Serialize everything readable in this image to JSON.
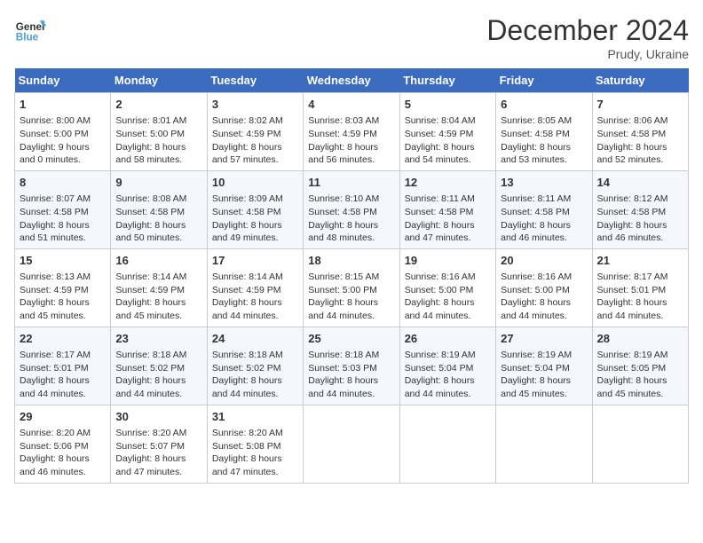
{
  "header": {
    "logo_line1": "General",
    "logo_line2": "Blue",
    "month": "December 2024",
    "location": "Prudy, Ukraine"
  },
  "weekdays": [
    "Sunday",
    "Monday",
    "Tuesday",
    "Wednesday",
    "Thursday",
    "Friday",
    "Saturday"
  ],
  "weeks": [
    [
      {
        "day": 1,
        "sunrise": "8:00 AM",
        "sunset": "5:00 PM",
        "daylight": "9 hours and 0 minutes."
      },
      {
        "day": 2,
        "sunrise": "8:01 AM",
        "sunset": "5:00 PM",
        "daylight": "8 hours and 58 minutes."
      },
      {
        "day": 3,
        "sunrise": "8:02 AM",
        "sunset": "4:59 PM",
        "daylight": "8 hours and 57 minutes."
      },
      {
        "day": 4,
        "sunrise": "8:03 AM",
        "sunset": "4:59 PM",
        "daylight": "8 hours and 56 minutes."
      },
      {
        "day": 5,
        "sunrise": "8:04 AM",
        "sunset": "4:59 PM",
        "daylight": "8 hours and 54 minutes."
      },
      {
        "day": 6,
        "sunrise": "8:05 AM",
        "sunset": "4:58 PM",
        "daylight": "8 hours and 53 minutes."
      },
      {
        "day": 7,
        "sunrise": "8:06 AM",
        "sunset": "4:58 PM",
        "daylight": "8 hours and 52 minutes."
      }
    ],
    [
      {
        "day": 8,
        "sunrise": "8:07 AM",
        "sunset": "4:58 PM",
        "daylight": "8 hours and 51 minutes."
      },
      {
        "day": 9,
        "sunrise": "8:08 AM",
        "sunset": "4:58 PM",
        "daylight": "8 hours and 50 minutes."
      },
      {
        "day": 10,
        "sunrise": "8:09 AM",
        "sunset": "4:58 PM",
        "daylight": "8 hours and 49 minutes."
      },
      {
        "day": 11,
        "sunrise": "8:10 AM",
        "sunset": "4:58 PM",
        "daylight": "8 hours and 48 minutes."
      },
      {
        "day": 12,
        "sunrise": "8:11 AM",
        "sunset": "4:58 PM",
        "daylight": "8 hours and 47 minutes."
      },
      {
        "day": 13,
        "sunrise": "8:11 AM",
        "sunset": "4:58 PM",
        "daylight": "8 hours and 46 minutes."
      },
      {
        "day": 14,
        "sunrise": "8:12 AM",
        "sunset": "4:58 PM",
        "daylight": "8 hours and 46 minutes."
      }
    ],
    [
      {
        "day": 15,
        "sunrise": "8:13 AM",
        "sunset": "4:59 PM",
        "daylight": "8 hours and 45 minutes."
      },
      {
        "day": 16,
        "sunrise": "8:14 AM",
        "sunset": "4:59 PM",
        "daylight": "8 hours and 45 minutes."
      },
      {
        "day": 17,
        "sunrise": "8:14 AM",
        "sunset": "4:59 PM",
        "daylight": "8 hours and 44 minutes."
      },
      {
        "day": 18,
        "sunrise": "8:15 AM",
        "sunset": "5:00 PM",
        "daylight": "8 hours and 44 minutes."
      },
      {
        "day": 19,
        "sunrise": "8:16 AM",
        "sunset": "5:00 PM",
        "daylight": "8 hours and 44 minutes."
      },
      {
        "day": 20,
        "sunrise": "8:16 AM",
        "sunset": "5:00 PM",
        "daylight": "8 hours and 44 minutes."
      },
      {
        "day": 21,
        "sunrise": "8:17 AM",
        "sunset": "5:01 PM",
        "daylight": "8 hours and 44 minutes."
      }
    ],
    [
      {
        "day": 22,
        "sunrise": "8:17 AM",
        "sunset": "5:01 PM",
        "daylight": "8 hours and 44 minutes."
      },
      {
        "day": 23,
        "sunrise": "8:18 AM",
        "sunset": "5:02 PM",
        "daylight": "8 hours and 44 minutes."
      },
      {
        "day": 24,
        "sunrise": "8:18 AM",
        "sunset": "5:02 PM",
        "daylight": "8 hours and 44 minutes."
      },
      {
        "day": 25,
        "sunrise": "8:18 AM",
        "sunset": "5:03 PM",
        "daylight": "8 hours and 44 minutes."
      },
      {
        "day": 26,
        "sunrise": "8:19 AM",
        "sunset": "5:04 PM",
        "daylight": "8 hours and 44 minutes."
      },
      {
        "day": 27,
        "sunrise": "8:19 AM",
        "sunset": "5:04 PM",
        "daylight": "8 hours and 45 minutes."
      },
      {
        "day": 28,
        "sunrise": "8:19 AM",
        "sunset": "5:05 PM",
        "daylight": "8 hours and 45 minutes."
      }
    ],
    [
      {
        "day": 29,
        "sunrise": "8:20 AM",
        "sunset": "5:06 PM",
        "daylight": "8 hours and 46 minutes."
      },
      {
        "day": 30,
        "sunrise": "8:20 AM",
        "sunset": "5:07 PM",
        "daylight": "8 hours and 47 minutes."
      },
      {
        "day": 31,
        "sunrise": "8:20 AM",
        "sunset": "5:08 PM",
        "daylight": "8 hours and 47 minutes."
      },
      null,
      null,
      null,
      null
    ]
  ]
}
